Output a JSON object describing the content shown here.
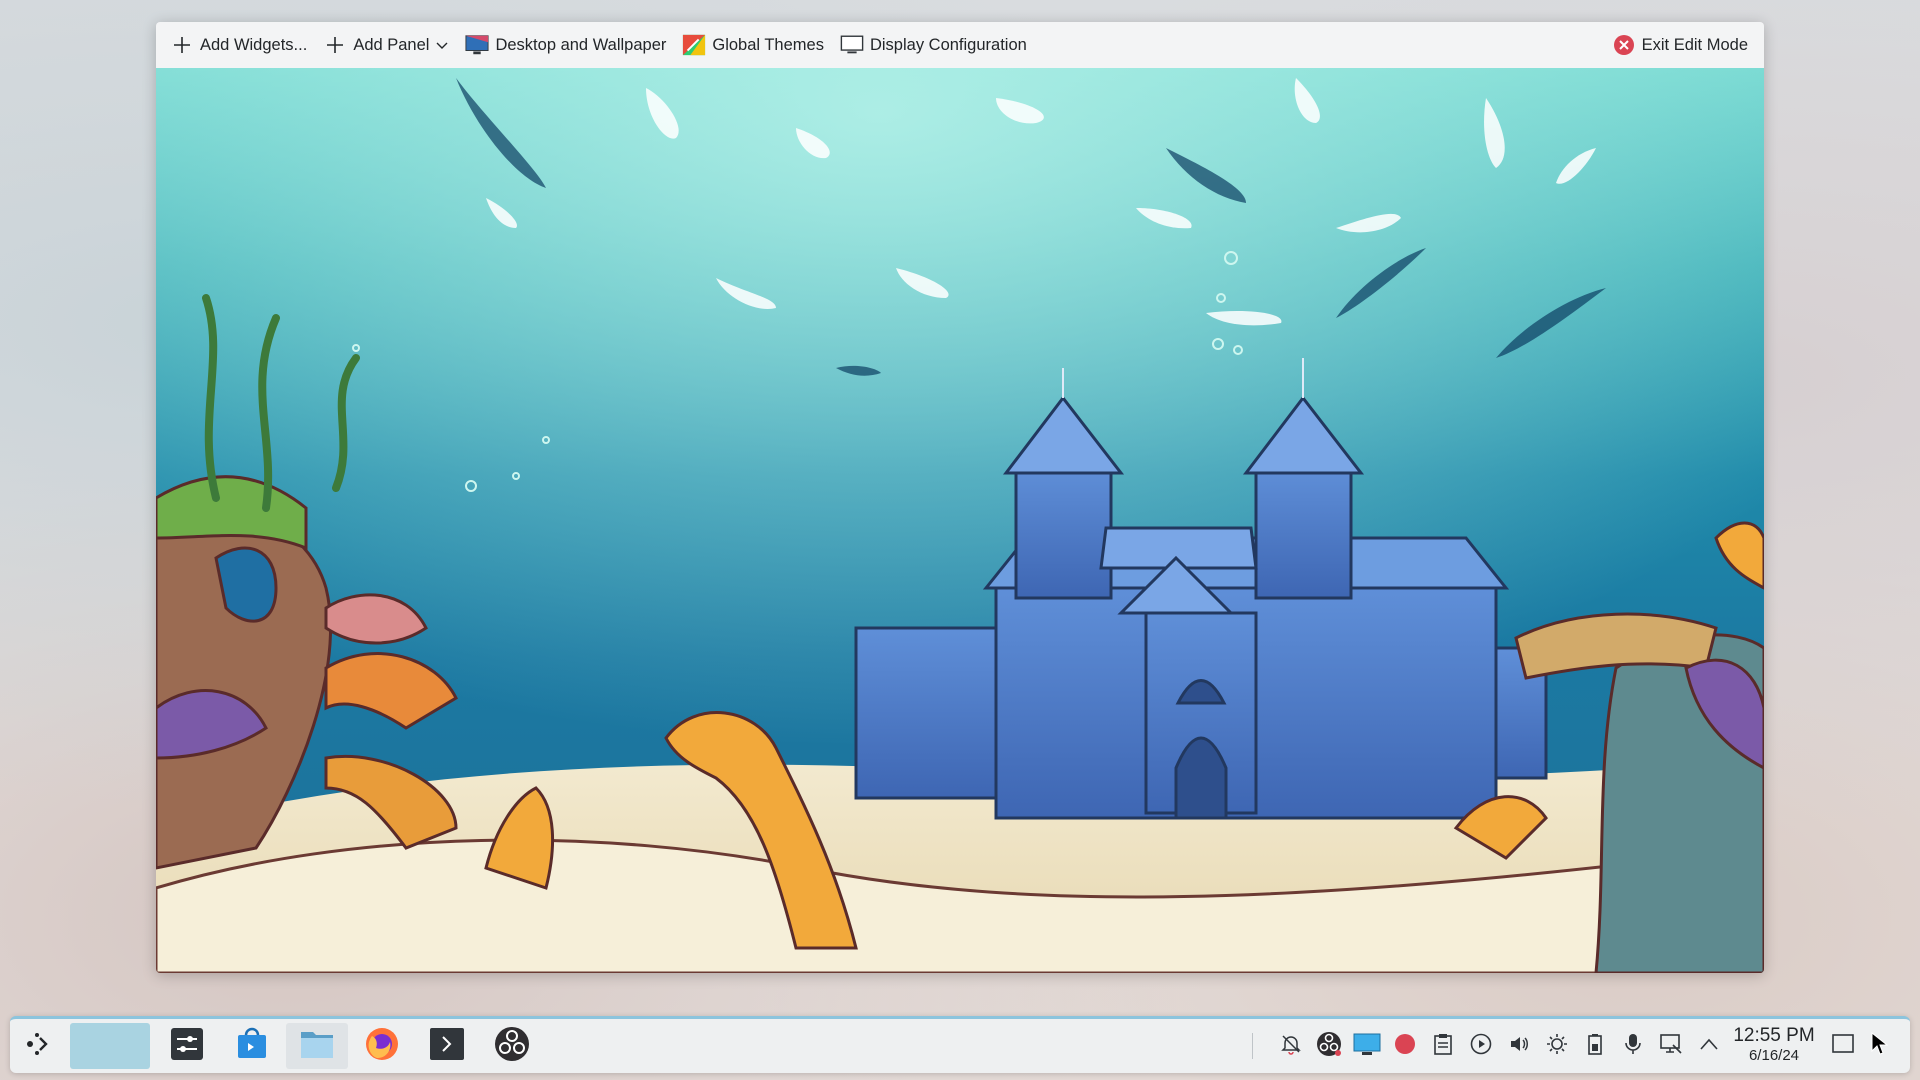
{
  "toolbar": {
    "add_widgets": "Add Widgets...",
    "add_panel": "Add Panel",
    "desktop_wallpaper": "Desktop and Wallpaper",
    "global_themes": "Global Themes",
    "display_configuration": "Display Configuration",
    "exit_edit_mode": "Exit Edit Mode"
  },
  "taskbar": {
    "apps": [
      "application-launcher-icon",
      "desktop-pager",
      "system-settings-icon",
      "discover-store-icon",
      "file-manager-icon",
      "firefox-icon",
      "terminal-icon",
      "obs-studio-icon"
    ],
    "tray": [
      "notifications-off-icon",
      "obs-tray-icon",
      "display-tray-icon",
      "record-icon",
      "clipboard-icon",
      "media-player-icon",
      "volume-icon",
      "brightness-icon",
      "battery-icon",
      "microphone-icon",
      "network-icon",
      "expand-tray-icon"
    ],
    "time": "12:55 PM",
    "date": "6/16/24"
  },
  "colors": {
    "accent": "#3daee9",
    "exit_red": "#da4453",
    "panel_bg": "#eef0f1"
  }
}
